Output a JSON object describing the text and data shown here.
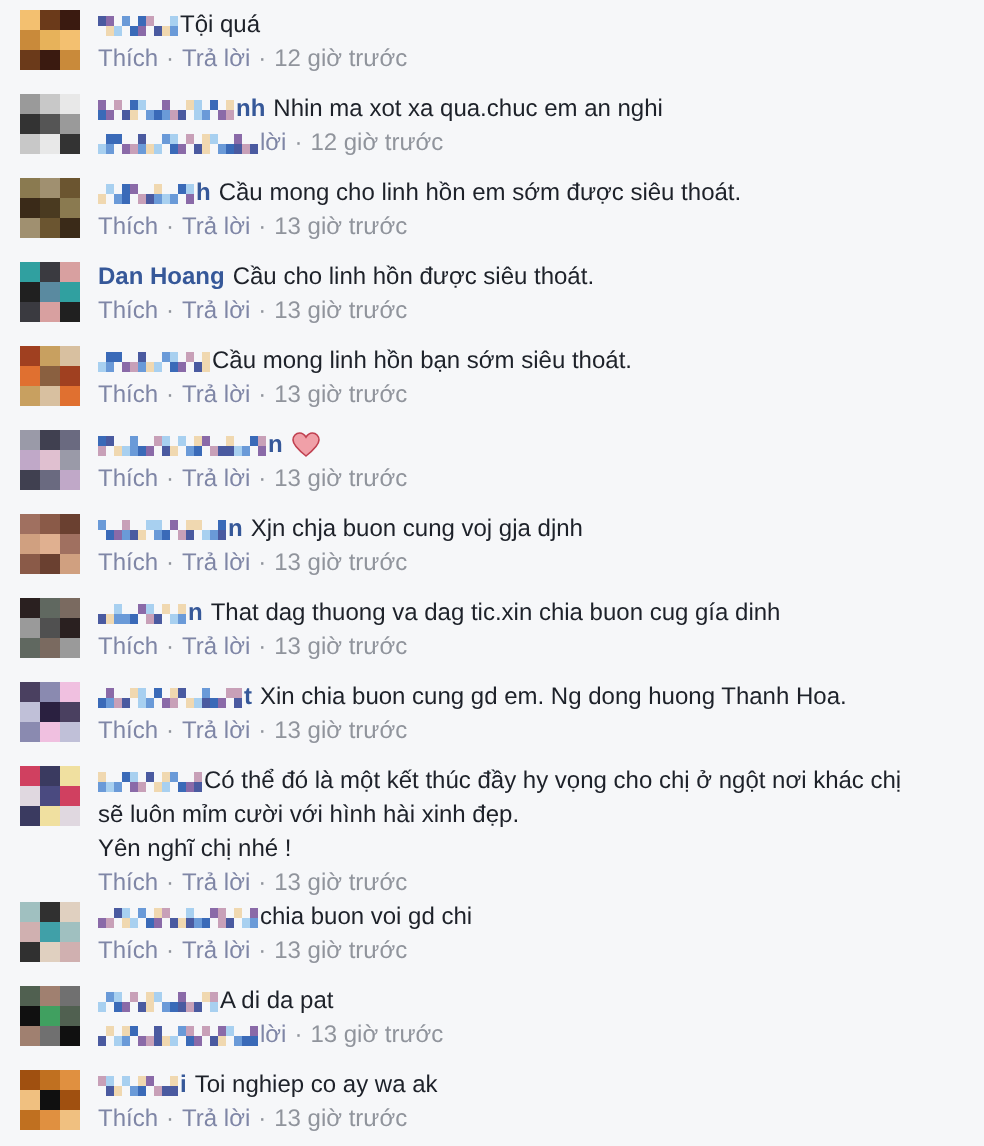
{
  "comments": [
    {
      "name_hidden": true,
      "text": "Tội quá",
      "heart": false,
      "actions_hidden": false,
      "actions": [
        "Thích",
        "·",
        "Trả lời",
        "·"
      ],
      "time": "12 giờ trước"
    },
    {
      "name_hidden": true,
      "name": "nh",
      "text": "Nhin ma xot xa qua.chuc em an nghi",
      "heart": false,
      "actions_hidden": true,
      "actions": [
        "lời",
        "·"
      ],
      "time": "12 giờ trước"
    },
    {
      "name_hidden": true,
      "name": "h",
      "text": "Cầu mong cho linh hồn em sớm được siêu thoát.",
      "heart": false,
      "actions_hidden": false,
      "actions": [
        "Thích",
        "·",
        "Trả lời",
        "·"
      ],
      "time": "13 giờ trước"
    },
    {
      "name_hidden": false,
      "name": "Dan Hoang",
      "text": "Cầu cho linh hồn được siêu thoát.",
      "heart": false,
      "actions_hidden": false,
      "actions": [
        "Thích",
        "·",
        "Trả lời",
        "·"
      ],
      "time": "13 giờ trước"
    },
    {
      "name_hidden": true,
      "text": "Cầu mong linh hồn bạn sớm siêu thoát.",
      "heart": false,
      "actions_hidden": false,
      "actions": [
        "Thích",
        "·",
        "Trả lời",
        "·"
      ],
      "time": "13 giờ trước"
    },
    {
      "name_hidden": true,
      "name": "n",
      "heart": true,
      "actions_hidden": false,
      "actions": [
        "Thích",
        "·",
        "Trả lời",
        "·"
      ],
      "time": "13 giờ trước"
    },
    {
      "name_hidden": true,
      "name": "n",
      "text": "Xjn chja buon cung voj gja djnh",
      "heart": false,
      "actions_hidden": false,
      "actions": [
        "Thích",
        "·",
        "Trả lời",
        "·"
      ],
      "time": "13 giờ trước"
    },
    {
      "name_hidden": true,
      "name": "n",
      "text": "That dag thuong va dag tic.xin chia buon cug gía dinh",
      "heart": false,
      "actions_hidden": false,
      "actions": [
        "Thích",
        "·",
        "Trả lời",
        "·"
      ],
      "time": "13 giờ trước"
    },
    {
      "name_hidden": true,
      "name": "t",
      "text": "Xin chia buon cung gd em. Ng dong huong Thanh Hoa.",
      "heart": false,
      "actions_hidden": false,
      "actions": [
        "Thích",
        "·",
        "Trả lời",
        "·"
      ],
      "time": "13 giờ trước"
    },
    {
      "name_hidden": true,
      "text": "Có thể đó là một kết thúc đầy hy vọng cho chị ở ngột nơi khác chị",
      "more_lines": [
        "sẽ luôn mỉm cười với hình hài xinh đẹp.",
        "Yên nghĩ chị nhé !"
      ],
      "heart": false,
      "actions_hidden": false,
      "actions": [
        "Thích",
        "·",
        "Trả lời",
        "·"
      ],
      "time": "13 giờ trước"
    },
    {
      "name_hidden": true,
      "text": "chia buon voi gd chi",
      "heart": false,
      "actions_hidden": false,
      "actions": [
        "Thích",
        "·",
        "Trả lời",
        "·"
      ],
      "time": "13 giờ trước"
    },
    {
      "name_hidden": true,
      "text": "A di da pat",
      "heart": false,
      "actions_hidden": true,
      "actions": [
        "lời",
        "·"
      ],
      "time": "13 giờ trước"
    },
    {
      "name_hidden": true,
      "name": "i",
      "text": "Toi nghiep co ay wa ak",
      "heart": false,
      "actions_hidden": false,
      "actions": [
        "Thích",
        "·",
        "Trả lời",
        "·"
      ],
      "time": "13 giờ trước"
    }
  ]
}
